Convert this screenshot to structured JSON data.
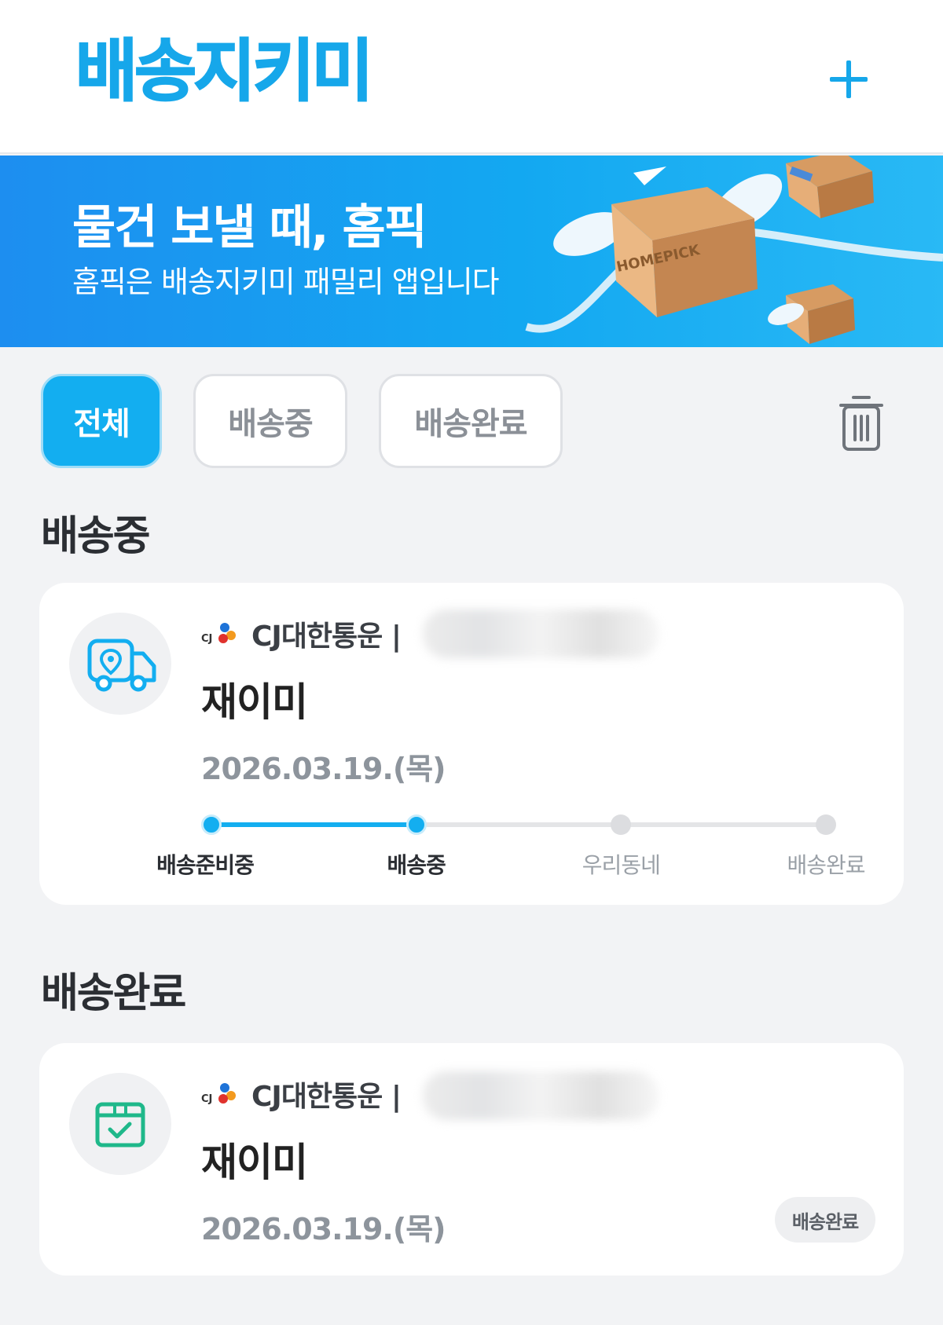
{
  "header": {
    "logo_text": "배송지키미",
    "add_icon": "plus-icon"
  },
  "banner": {
    "title": "물건 보낼 때, 홈픽",
    "subtitle": "홈픽은 배송지키미 패밀리 앱입니다",
    "box_brand": "HOMEPICK"
  },
  "filters": {
    "tabs": [
      {
        "label": "전체",
        "selected": true
      },
      {
        "label": "배송중",
        "selected": false
      },
      {
        "label": "배송완료",
        "selected": false
      }
    ],
    "delete_icon": "trash-icon"
  },
  "sections": [
    {
      "title": "배송중",
      "items": [
        {
          "icon": "delivery-truck-icon",
          "carrier": "CJ대한통운 |",
          "name": "재이미",
          "date": "2026.03.19.(목)",
          "progress": {
            "current_step": 2,
            "total_steps": 4,
            "steps": [
              "배송준비중",
              "배송중",
              "우리동네",
              "배송완료"
            ]
          }
        }
      ]
    },
    {
      "title": "배송완료",
      "items": [
        {
          "icon": "box-check-icon",
          "carrier": "CJ대한통운 |",
          "name": "재이미",
          "date": "2026.03.19.(목)",
          "badge": "배송완료"
        }
      ]
    }
  ],
  "colors": {
    "accent": "#13aef0",
    "done_icon": "#1fb88a",
    "background": "#f2f3f5"
  }
}
